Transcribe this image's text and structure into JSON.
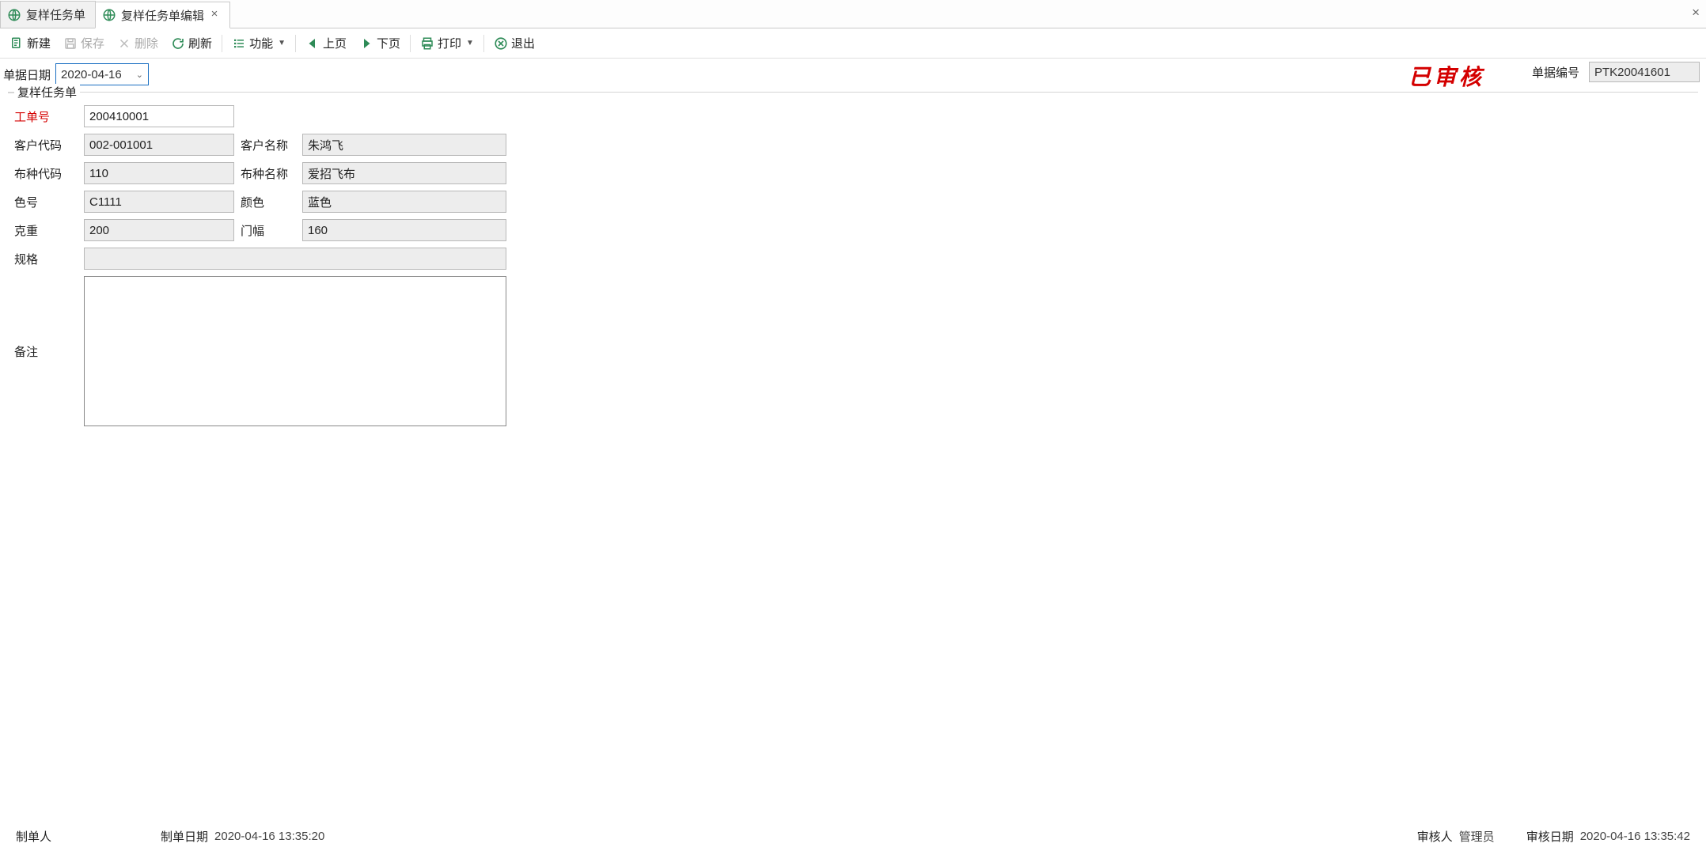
{
  "tabs": {
    "list_label": "复样任务单",
    "edit_label": "复样任务单编辑"
  },
  "toolbar": {
    "new_label": "新建",
    "save_label": "保存",
    "delete_label": "删除",
    "refresh_label": "刷新",
    "function_label": "功能",
    "prev_label": "上页",
    "next_label": "下页",
    "print_label": "打印",
    "exit_label": "退出"
  },
  "header": {
    "date_label": "单据日期",
    "date_value": "2020-04-16",
    "status_stamp": "已审核",
    "docnum_label": "单据编号",
    "docnum_value": "PTK20041601"
  },
  "form": {
    "legend": "复样任务单",
    "labels": {
      "work_order": "工单号",
      "customer_code": "客户代码",
      "customer_name": "客户名称",
      "fabric_code": "布种代码",
      "fabric_name": "布种名称",
      "color_no": "色号",
      "color": "颜色",
      "weight": "克重",
      "width": "门幅",
      "spec": "规格",
      "remark": "备注"
    },
    "values": {
      "work_order": "200410001",
      "customer_code": "002-001001",
      "customer_name": "朱鸿飞",
      "fabric_code": "110",
      "fabric_name": "爱招飞布",
      "color_no": "C1111",
      "color": "蓝色",
      "weight": "200",
      "width": "160",
      "spec": "",
      "remark": ""
    }
  },
  "footer": {
    "creator_label": "制单人",
    "creator_value": "",
    "create_date_label": "制单日期",
    "create_date_value": "2020-04-16 13:35:20",
    "auditor_label": "审核人",
    "auditor_value": "管理员",
    "audit_date_label": "审核日期",
    "audit_date_value": "2020-04-16 13:35:42"
  }
}
